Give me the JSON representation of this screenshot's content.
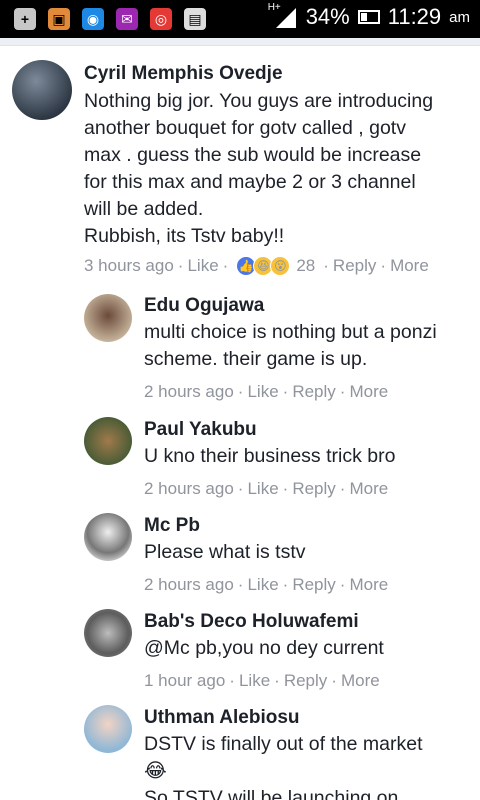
{
  "status_bar": {
    "battery": "34%",
    "time": "11:29",
    "ampm": "am",
    "network": "H+"
  },
  "comments": [
    {
      "author": "Cyril Memphis Ovedje",
      "lines": [
        "Nothing big jor. You guys are introducing",
        "another bouquet for gotv called , gotv",
        "max . guess the sub would be increase",
        "for this max and maybe 2 or 3 channel",
        "will be added.",
        "Rubbish, its Tstv baby!!"
      ],
      "time": "3 hours ago",
      "like": "Like",
      "reaction_count": "28",
      "reply": "Reply",
      "more": "More"
    },
    {
      "author": "Edu Ogujawa",
      "lines": [
        "multi choice is nothing but a ponzi",
        "scheme. their game is up."
      ],
      "time": "2 hours ago",
      "like": "Like",
      "reply": "Reply",
      "more": "More"
    },
    {
      "author": "Paul Yakubu",
      "lines": [
        "U kno their business trick bro"
      ],
      "time": "2 hours ago",
      "like": "Like",
      "reply": "Reply",
      "more": "More"
    },
    {
      "author": "Mc Pb",
      "lines": [
        "Please what is tstv"
      ],
      "time": "2 hours ago",
      "like": "Like",
      "reply": "Reply",
      "more": "More"
    },
    {
      "author": "Bab's Deco Holuwafemi",
      "lines": [
        "@Mc pb,you no dey current"
      ],
      "time": "1 hour ago",
      "like": "Like",
      "reply": "Reply",
      "more": "More"
    },
    {
      "author": "Uthman Alebiosu",
      "lines": [
        "DSTV is finally out of the market",
        "😂",
        "So TSTV will be launching on"
      ]
    }
  ],
  "colors": {
    "text": "#1d2129",
    "meta": "#90949c",
    "like_reaction": "#4a76e8",
    "haha_reaction": "#f7c23b"
  }
}
